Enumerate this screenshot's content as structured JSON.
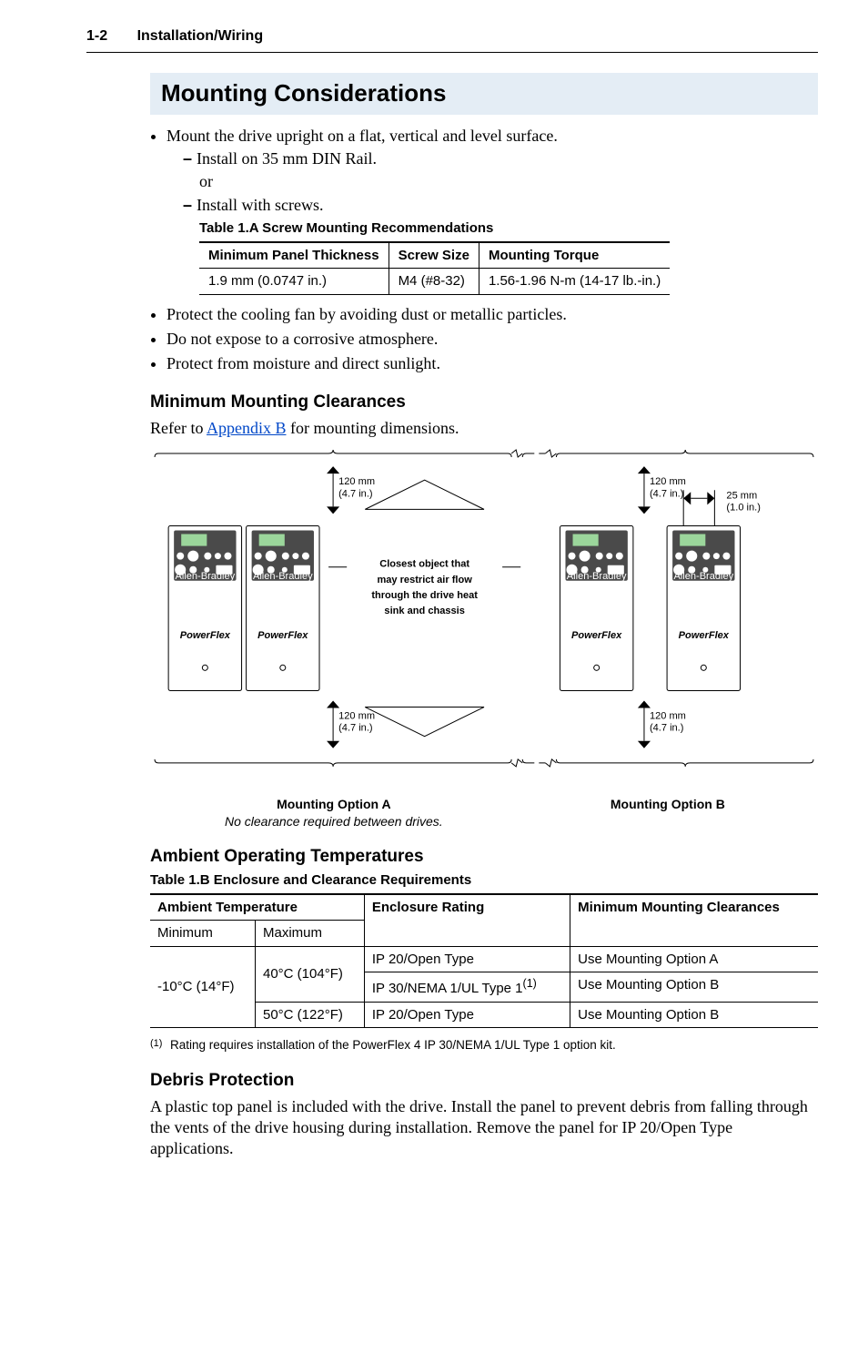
{
  "header": {
    "section": "1-2",
    "chapter": "Installation/Wiring"
  },
  "title": "Mounting Considerations",
  "bullets": {
    "b1": "Mount the drive upright on a flat, vertical and level surface.",
    "b1a": "Install on 35 mm DIN Rail.",
    "or": "or",
    "b1b": "Install with screws.",
    "b2": "Protect the cooling fan by avoiding dust or metallic particles.",
    "b3": "Do not expose to a corrosive atmosphere.",
    "b4": "Protect from moisture and direct sunlight."
  },
  "table1a": {
    "caption": "Table 1.A   Screw Mounting Recommendations",
    "h1": "Minimum Panel Thickness",
    "h2": "Screw Size",
    "h3": "Mounting Torque",
    "r1c1": "1.9 mm (0.0747 in.)",
    "r1c2": "M4 (#8-32)",
    "r1c3": "1.56-1.96 N-m (14-17 lb.-in.)"
  },
  "mmc": {
    "heading": "Minimum Mounting Clearances",
    "text_a": "Refer to ",
    "link": "Appendix B",
    "text_b": " for mounting dimensions."
  },
  "diagram": {
    "dim_top_mm": "120 mm",
    "dim_top_in": "(4.7 in.)",
    "dim_bot_mm": "120 mm",
    "dim_bot_in": "(4.7 in.)",
    "side_mm": "25 mm",
    "side_in": "(1.0 in.)",
    "note_l1": "Closest object that",
    "note_l2": "may restrict air flow",
    "note_l3": "through the drive heat",
    "note_l4": "sink and chassis",
    "brand": "Allen-Bradley",
    "pflex": "PowerFlex",
    "optA": "Mounting Option A",
    "optA_sub": "No clearance required between drives.",
    "optB": "Mounting Option B"
  },
  "aot": {
    "heading": "Ambient Operating Temperatures",
    "caption": "Table 1.B   Enclosure and Clearance Requirements",
    "h_amb": "Ambient Temperature",
    "h_enc": "Enclosure Rating",
    "h_mm": "Minimum Mounting Clearances",
    "h_min": "Minimum",
    "h_max": "Maximum",
    "min": "-10°C (14°F)",
    "max1": "40°C (104°F)",
    "max2": "50°C (122°F)",
    "enc1": "IP 20/Open Type",
    "enc2_a": "IP 30/NEMA 1/UL Type 1",
    "enc2_sup": "(1)",
    "enc3": "IP 20/Open Type",
    "clr1": "Use Mounting Option A",
    "clr2": "Use Mounting Option B",
    "clr3": "Use Mounting Option B",
    "fn_sup": "(1)",
    "fn": "Rating requires installation of the PowerFlex 4 IP 30/NEMA 1/UL Type 1 option kit."
  },
  "debris": {
    "heading": "Debris Protection",
    "text": "A plastic top panel is included with the drive. Install the panel to prevent debris from falling through the vents of the drive housing during installation. Remove the panel for IP 20/Open Type applications."
  }
}
